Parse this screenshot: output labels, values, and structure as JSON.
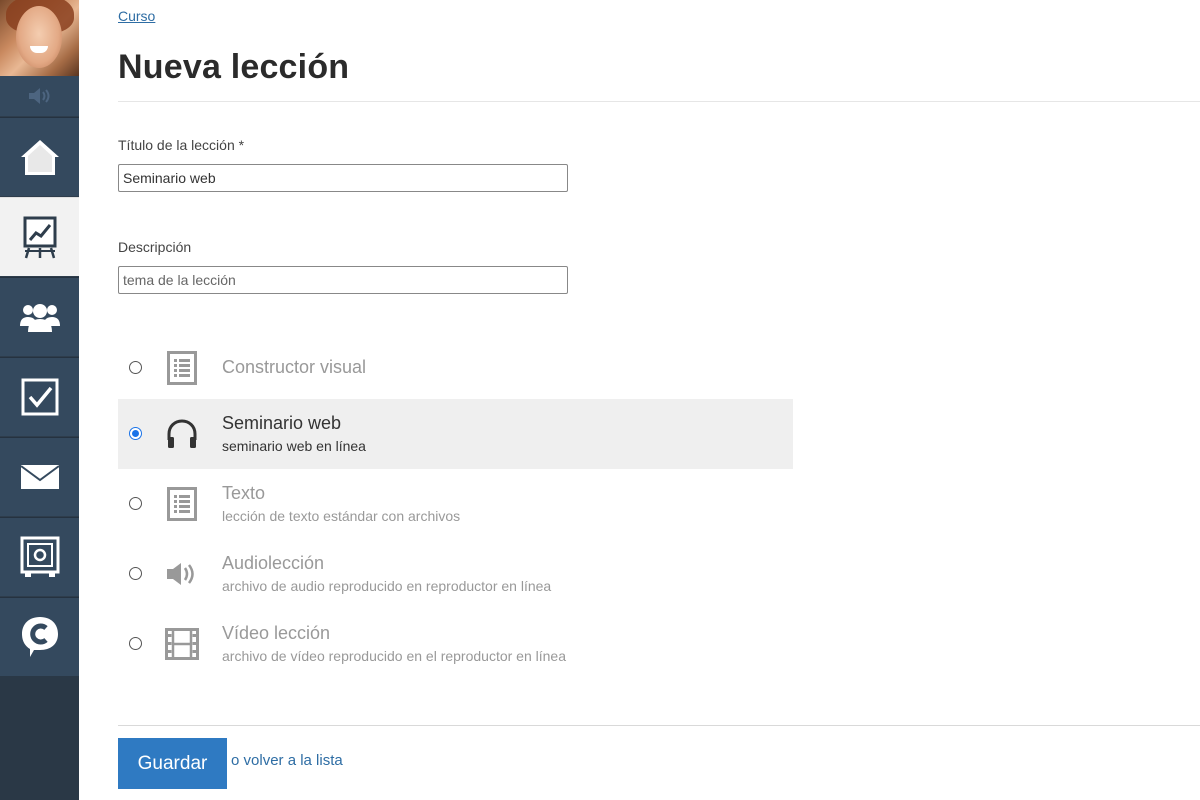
{
  "breadcrumb": "Curso",
  "page_title": "Nueva lección",
  "form": {
    "title_label": "Título de la lección *",
    "title_value": "Seminario web",
    "description_label": "Descripción",
    "description_placeholder": "tema de la lección"
  },
  "lesson_types": [
    {
      "title": "Constructor visual",
      "description": "",
      "icon": "list-document-icon",
      "selected": false
    },
    {
      "title": "Seminario web",
      "description": "seminario web en línea",
      "icon": "headphones-icon",
      "selected": true
    },
    {
      "title": "Texto",
      "description": "lección de texto estándar con archivos",
      "icon": "list-document-icon",
      "selected": false
    },
    {
      "title": "Audiolección",
      "description": "archivo de audio reproducido en reproductor en línea",
      "icon": "speaker-icon",
      "selected": false
    },
    {
      "title": "Vídeo lección",
      "description": "archivo de vídeo reproducido en el reproductor en línea",
      "icon": "film-icon",
      "selected": false
    }
  ],
  "actions": {
    "save_label": "Guardar",
    "or_text": "o",
    "back_label": "volver a la lista"
  },
  "sidebar": {
    "items": [
      {
        "icon": "home-icon"
      },
      {
        "icon": "presentation-chart-icon",
        "active": true
      },
      {
        "icon": "users-group-icon"
      },
      {
        "icon": "checkbox-icon"
      },
      {
        "icon": "mail-icon"
      },
      {
        "icon": "safe-icon"
      },
      {
        "icon": "chat-c-icon"
      }
    ]
  },
  "colors": {
    "sidebar": "#34495e",
    "accent": "#2f7ac2",
    "link": "#2e6da4",
    "selected_row": "#efefef"
  }
}
